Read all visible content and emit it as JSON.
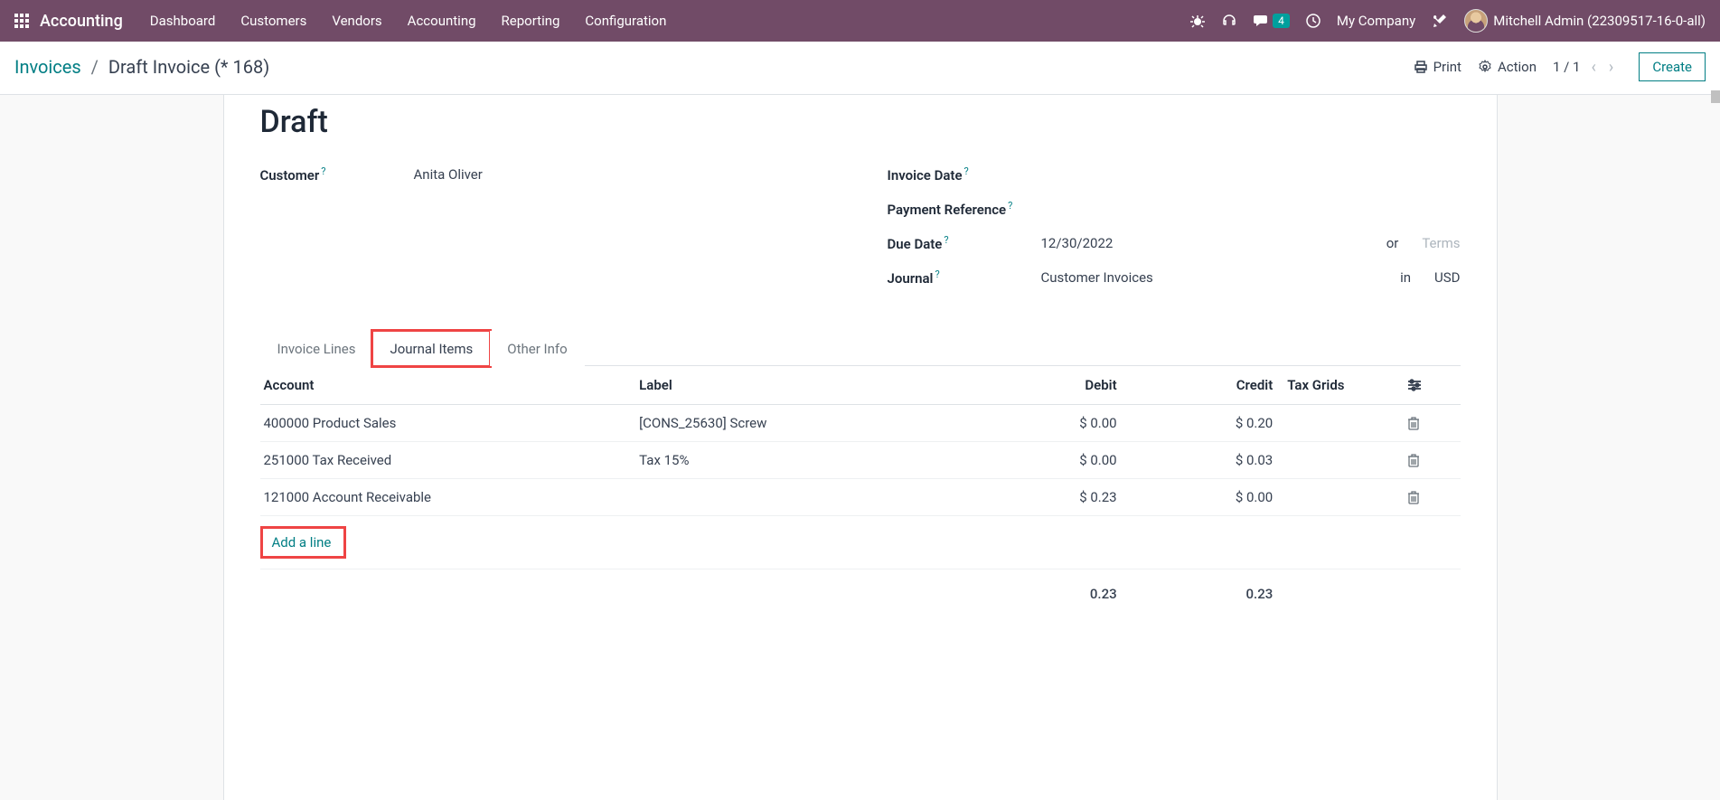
{
  "navbar": {
    "brand": "Accounting",
    "menu": [
      "Dashboard",
      "Customers",
      "Vendors",
      "Accounting",
      "Reporting",
      "Configuration"
    ],
    "chat_badge": "4",
    "company": "My Company",
    "user": "Mitchell Admin (22309517-16-0-all)"
  },
  "control": {
    "breadcrumb_root": "Invoices",
    "breadcrumb_current": "Draft Invoice (* 168)",
    "print": "Print",
    "action": "Action",
    "pager": "1 / 1",
    "create": "Create"
  },
  "form": {
    "status": "Draft",
    "left": {
      "customer_label": "Customer",
      "customer_value": "Anita Oliver"
    },
    "right": {
      "invoice_date_label": "Invoice Date",
      "invoice_date_value": "",
      "payment_ref_label": "Payment Reference",
      "payment_ref_value": "",
      "due_date_label": "Due Date",
      "due_date_value": "12/30/2022",
      "due_date_or": "or",
      "terms_placeholder": "Terms",
      "journal_label": "Journal",
      "journal_value": "Customer Invoices",
      "journal_in": "in",
      "currency": "USD"
    }
  },
  "tabs": [
    "Invoice Lines",
    "Journal Items",
    "Other Info"
  ],
  "table": {
    "headers": {
      "account": "Account",
      "label": "Label",
      "debit": "Debit",
      "credit": "Credit",
      "tax_grids": "Tax Grids"
    },
    "rows": [
      {
        "account": "400000 Product Sales",
        "label": "[CONS_25630] Screw",
        "debit": "$ 0.00",
        "credit": "$ 0.20"
      },
      {
        "account": "251000 Tax Received",
        "label": "Tax 15%",
        "debit": "$ 0.00",
        "credit": "$ 0.03"
      },
      {
        "account": "121000 Account Receivable",
        "label": "",
        "debit": "$ 0.23",
        "credit": "$ 0.00"
      }
    ],
    "add_line": "Add a line",
    "totals": {
      "debit": "0.23",
      "credit": "0.23"
    }
  }
}
